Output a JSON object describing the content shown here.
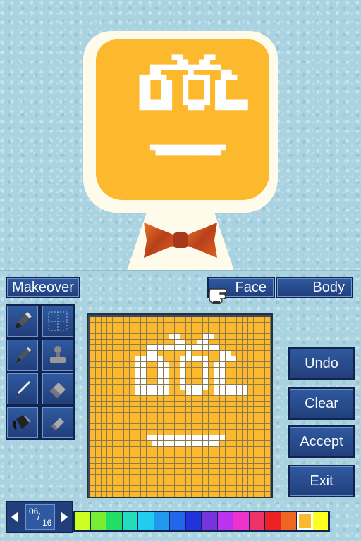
{
  "tabs": {
    "makeover": "Makeover",
    "face": "Face",
    "body": "Body"
  },
  "actions": {
    "undo": "Undo",
    "clear": "Clear",
    "accept": "Accept",
    "exit": "Exit"
  },
  "palette": {
    "page_current": "06",
    "page_total": "16",
    "swatches": [
      "#ccff22",
      "#77ee33",
      "#22dd66",
      "#22ddbb",
      "#22ccee",
      "#2299ee",
      "#2266ee",
      "#2233dd",
      "#7733dd",
      "#bb33ee",
      "#ee33cc",
      "#ee3366",
      "#ee2222",
      "#ee6622",
      "#fcb92d",
      "#ffff22"
    ],
    "selected_index": 14
  },
  "tools": [
    "pencil-thick-icon",
    "grid-select-icon",
    "pencil-medium-icon",
    "stamp-icon",
    "pencil-thin-icon",
    "eraser-thick-icon",
    "paint-bucket-icon",
    "eraser-thin-icon"
  ],
  "colors": {
    "face": "#fcb92d",
    "feature": "#ffffff",
    "outline": "#fffbea",
    "bowtie": "#c9501b",
    "grid_line": "#8a7a50"
  },
  "face_pixels": [
    "................................",
    "................................",
    "................................",
    "..............##....##..........",
    "...............##..##...........",
    "..........#############.........",
    "..........##.....#.....##.......",
    "........#####...#####..###......",
    "........##..##..#...#.##........",
    "........##..##..#...#.##........",
    "........##..##..#...#.##........",
    "........##..##..#...#.##........",
    "........######..#####.######....",
    "........######...###..######....",
    "................................",
    "................................",
    "................................",
    "................................",
    "................................",
    "................................",
    "................................",
    "..........##############........",
    "...........############.........",
    "................................",
    "................................",
    "................................",
    "................................",
    "................................",
    "................................",
    "................................",
    "................................",
    "................................"
  ]
}
